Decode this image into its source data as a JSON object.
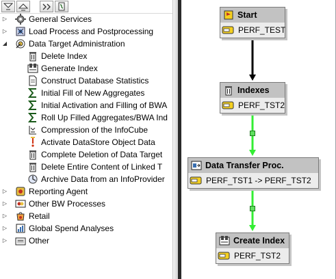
{
  "toolbar": {
    "buttons": [
      {
        "name": "expand-all-icon"
      },
      {
        "name": "collapse-all-icon"
      },
      {
        "name": "find-icon"
      },
      {
        "name": "process-chain-icon"
      }
    ]
  },
  "tree": {
    "items": [
      {
        "label": "General Services",
        "expander": "▷",
        "icon": "gear-icon"
      },
      {
        "label": "Load Process and Postprocessing",
        "expander": "▷",
        "icon": "load-process-icon"
      },
      {
        "label": "Data Target Administration",
        "expander": "◢",
        "icon": "target-icon"
      },
      {
        "label": "Delete Index",
        "expander": "",
        "icon": "trash-icon"
      },
      {
        "label": "Generate Index",
        "expander": "",
        "icon": "index-icon"
      },
      {
        "label": "Construct Database Statistics",
        "expander": "",
        "icon": "sheet-icon"
      },
      {
        "label": "Initial Fill of New Aggregates",
        "expander": "",
        "icon": "sigma-icon"
      },
      {
        "label": "Initial Activation and Filling of BWA",
        "expander": "",
        "icon": "sigma-icon"
      },
      {
        "label": "Roll Up Filled Aggregates/BWA Ind",
        "expander": "",
        "icon": "sigma-icon"
      },
      {
        "label": "Compression of the InfoCube",
        "expander": "",
        "icon": "compress-icon"
      },
      {
        "label": "Activate DataStore Object Data",
        "expander": "",
        "icon": "activate-icon"
      },
      {
        "label": "Complete Deletion of Data Target",
        "expander": "",
        "icon": "trash-icon"
      },
      {
        "label": "Delete Entire Content of Linked T",
        "expander": "",
        "icon": "trash-icon"
      },
      {
        "label": "Archive Data from an InfoProvider",
        "expander": "",
        "icon": "archive-icon"
      },
      {
        "label": "Reporting Agent",
        "expander": "▷",
        "icon": "reporting-agent-icon"
      },
      {
        "label": "Other BW Processes",
        "expander": "▷",
        "icon": "bw-processes-icon"
      },
      {
        "label": "Retail",
        "expander": "▷",
        "icon": "retail-icon"
      },
      {
        "label": "Global Spend Analyses",
        "expander": "▷",
        "icon": "spend-icon"
      },
      {
        "label": "Other",
        "expander": "▷",
        "icon": "folder-icon"
      }
    ]
  },
  "chain": {
    "nodes": [
      {
        "title": "Start",
        "variant": "PERF_TEST",
        "icon": "start-icon"
      },
      {
        "title": "Indexes",
        "variant": "PERF_TST2",
        "icon": "trash-icon"
      },
      {
        "title": "Data Transfer Proc.",
        "variant": "PERF_TST1 -> PERF_TST2",
        "icon": "dtp-icon"
      },
      {
        "title": "Create Index",
        "variant": "PERF_TST2",
        "icon": "index-icon"
      }
    ],
    "link_colors": {
      "unconditional": "#000000",
      "success": "#33ee33"
    }
  }
}
